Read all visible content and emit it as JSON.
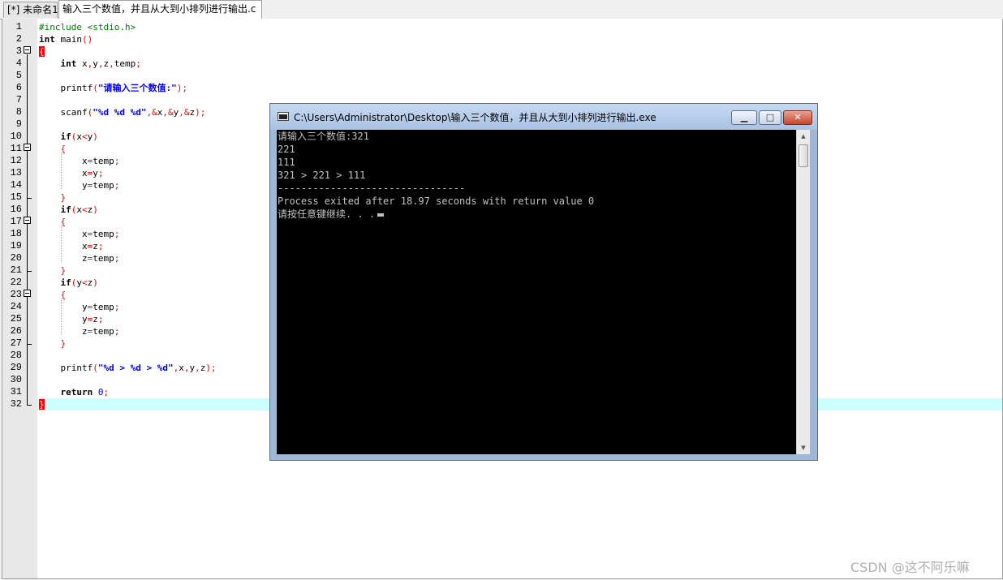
{
  "tabs": [
    {
      "label": "[*] 未命名1"
    },
    {
      "label": "输入三个数值，并且从大到小排列进行输出.c"
    }
  ],
  "editor": {
    "lines": [
      {
        "n": "1",
        "segs": [
          {
            "t": "#include <stdio.h>",
            "c": "pp"
          }
        ]
      },
      {
        "n": "2",
        "segs": [
          {
            "t": "int",
            "c": "kw"
          },
          {
            "t": " main"
          },
          {
            "t": "()",
            "c": "sym"
          }
        ]
      },
      {
        "n": "3",
        "segs": [
          {
            "t": "{",
            "c": "brace match"
          }
        ]
      },
      {
        "n": "4",
        "segs": [
          {
            "t": "    "
          },
          {
            "t": "int",
            "c": "kw"
          },
          {
            "t": " x"
          },
          {
            "t": ",",
            "c": "sym"
          },
          {
            "t": "y"
          },
          {
            "t": ",",
            "c": "sym"
          },
          {
            "t": "z"
          },
          {
            "t": ",",
            "c": "sym"
          },
          {
            "t": "temp"
          },
          {
            "t": ";",
            "c": "sym"
          }
        ]
      },
      {
        "n": "5",
        "segs": []
      },
      {
        "n": "6",
        "segs": [
          {
            "t": "    printf"
          },
          {
            "t": "(",
            "c": "sym"
          },
          {
            "t": "\"请输入三个数值:\"",
            "c": "str"
          },
          {
            "t": ");",
            "c": "sym"
          }
        ]
      },
      {
        "n": "7",
        "segs": []
      },
      {
        "n": "8",
        "segs": [
          {
            "t": "    scanf"
          },
          {
            "t": "(",
            "c": "sym"
          },
          {
            "t": "\"%d %d %d\"",
            "c": "str"
          },
          {
            "t": ",&",
            "c": "sym"
          },
          {
            "t": "x"
          },
          {
            "t": ",&",
            "c": "sym"
          },
          {
            "t": "y"
          },
          {
            "t": ",&",
            "c": "sym"
          },
          {
            "t": "z"
          },
          {
            "t": ");",
            "c": "sym"
          }
        ]
      },
      {
        "n": "9",
        "segs": []
      },
      {
        "n": "10",
        "segs": [
          {
            "t": "    "
          },
          {
            "t": "if",
            "c": "kw"
          },
          {
            "t": "(",
            "c": "sym"
          },
          {
            "t": "x"
          },
          {
            "t": "<",
            "c": "sym"
          },
          {
            "t": "y"
          },
          {
            "t": ")",
            "c": "sym"
          }
        ]
      },
      {
        "n": "11",
        "segs": [
          {
            "t": "    "
          },
          {
            "t": "{",
            "c": "brace"
          }
        ]
      },
      {
        "n": "12",
        "segs": [
          {
            "t": "        x"
          },
          {
            "t": "=",
            "c": "sym"
          },
          {
            "t": "temp"
          },
          {
            "t": ";",
            "c": "sym"
          }
        ]
      },
      {
        "n": "13",
        "segs": [
          {
            "t": "        x"
          },
          {
            "t": "=",
            "c": "sym"
          },
          {
            "t": "y"
          },
          {
            "t": ";",
            "c": "sym"
          }
        ]
      },
      {
        "n": "14",
        "segs": [
          {
            "t": "        y"
          },
          {
            "t": "=",
            "c": "sym"
          },
          {
            "t": "temp"
          },
          {
            "t": ";",
            "c": "sym"
          }
        ]
      },
      {
        "n": "15",
        "segs": [
          {
            "t": "    "
          },
          {
            "t": "}",
            "c": "brace"
          }
        ]
      },
      {
        "n": "16",
        "segs": [
          {
            "t": "    "
          },
          {
            "t": "if",
            "c": "kw"
          },
          {
            "t": "(",
            "c": "sym"
          },
          {
            "t": "x"
          },
          {
            "t": "<",
            "c": "sym"
          },
          {
            "t": "z"
          },
          {
            "t": ")",
            "c": "sym"
          }
        ]
      },
      {
        "n": "17",
        "segs": [
          {
            "t": "    "
          },
          {
            "t": "{",
            "c": "brace"
          }
        ]
      },
      {
        "n": "18",
        "segs": [
          {
            "t": "        x"
          },
          {
            "t": "=",
            "c": "sym"
          },
          {
            "t": "temp"
          },
          {
            "t": ";",
            "c": "sym"
          }
        ]
      },
      {
        "n": "19",
        "segs": [
          {
            "t": "        x"
          },
          {
            "t": "=",
            "c": "sym"
          },
          {
            "t": "z"
          },
          {
            "t": ";",
            "c": "sym"
          }
        ]
      },
      {
        "n": "20",
        "segs": [
          {
            "t": "        z"
          },
          {
            "t": "=",
            "c": "sym"
          },
          {
            "t": "temp"
          },
          {
            "t": ";",
            "c": "sym"
          }
        ]
      },
      {
        "n": "21",
        "segs": [
          {
            "t": "    "
          },
          {
            "t": "}",
            "c": "brace"
          }
        ]
      },
      {
        "n": "22",
        "segs": [
          {
            "t": "    "
          },
          {
            "t": "if",
            "c": "kw"
          },
          {
            "t": "(",
            "c": "sym"
          },
          {
            "t": "y"
          },
          {
            "t": "<",
            "c": "sym"
          },
          {
            "t": "z"
          },
          {
            "t": ")",
            "c": "sym"
          }
        ]
      },
      {
        "n": "23",
        "segs": [
          {
            "t": "    "
          },
          {
            "t": "{",
            "c": "brace"
          }
        ]
      },
      {
        "n": "24",
        "segs": [
          {
            "t": "        y"
          },
          {
            "t": "=",
            "c": "sym"
          },
          {
            "t": "temp"
          },
          {
            "t": ";",
            "c": "sym"
          }
        ]
      },
      {
        "n": "25",
        "segs": [
          {
            "t": "        y"
          },
          {
            "t": "=",
            "c": "sym"
          },
          {
            "t": "z"
          },
          {
            "t": ";",
            "c": "sym"
          }
        ]
      },
      {
        "n": "26",
        "segs": [
          {
            "t": "        z"
          },
          {
            "t": "=",
            "c": "sym"
          },
          {
            "t": "temp"
          },
          {
            "t": ";",
            "c": "sym"
          }
        ]
      },
      {
        "n": "27",
        "segs": [
          {
            "t": "    "
          },
          {
            "t": "}",
            "c": "brace"
          }
        ]
      },
      {
        "n": "28",
        "segs": []
      },
      {
        "n": "29",
        "segs": [
          {
            "t": "    printf"
          },
          {
            "t": "(",
            "c": "sym"
          },
          {
            "t": "\"%d > %d > %d\"",
            "c": "str"
          },
          {
            "t": ",",
            "c": "sym"
          },
          {
            "t": "x"
          },
          {
            "t": ",",
            "c": "sym"
          },
          {
            "t": "y"
          },
          {
            "t": ",",
            "c": "sym"
          },
          {
            "t": "z"
          },
          {
            "t": ");",
            "c": "sym"
          }
        ]
      },
      {
        "n": "30",
        "segs": []
      },
      {
        "n": "31",
        "segs": [
          {
            "t": "    "
          },
          {
            "t": "return",
            "c": "kw"
          },
          {
            "t": " "
          },
          {
            "t": "0",
            "c": "num"
          },
          {
            "t": ";",
            "c": "sym"
          }
        ]
      },
      {
        "n": "32",
        "segs": [
          {
            "t": "}",
            "c": "brace match"
          }
        ]
      }
    ]
  },
  "console": {
    "title": "C:\\Users\\Administrator\\Desktop\\输入三个数值，并且从大到小排列进行输出.exe",
    "output": [
      "请输入三个数值:321",
      "221",
      "111",
      "321 > 221 > 111",
      "--------------------------------",
      "Process exited after 18.97 seconds with return value 0",
      "请按任意键继续. . ."
    ],
    "minimize_glyph": "▁",
    "maximize_glyph": "□",
    "close_glyph": "✕",
    "scroll_up_glyph": "▲",
    "scroll_down_glyph": "▼"
  },
  "watermark": "CSDN @这不阿乐嘛"
}
